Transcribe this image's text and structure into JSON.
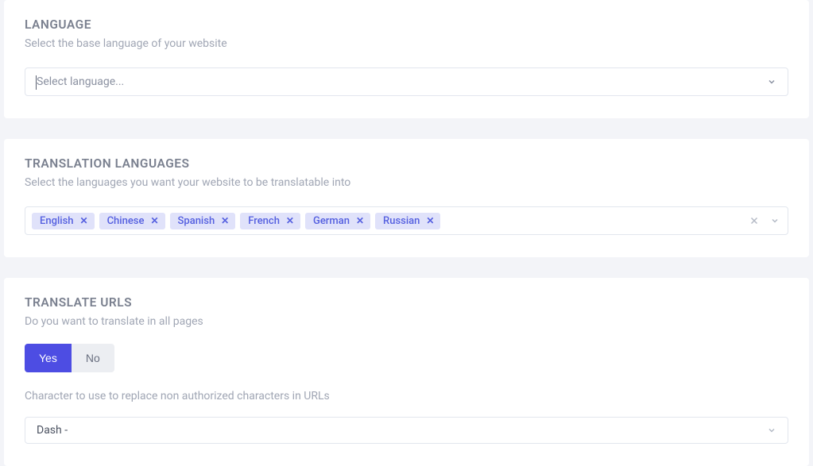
{
  "language": {
    "title": "LANGUAGE",
    "subtitle": "Select the base language of your website",
    "placeholder": "Select language..."
  },
  "translation_languages": {
    "title": "TRANSLATION LANGUAGES",
    "subtitle": "Select the languages you want your website to be translatable into",
    "tags": [
      "English",
      "Chinese",
      "Spanish",
      "French",
      "German",
      "Russian"
    ]
  },
  "translate_urls": {
    "title": "TRANSLATE URLS",
    "subtitle": "Do you want to translate in all pages",
    "yes_label": "Yes",
    "no_label": "No",
    "char_label": "Character to use to replace non authorized characters in URLs",
    "char_value": "Dash -"
  },
  "icons": {
    "remove": "✕"
  }
}
